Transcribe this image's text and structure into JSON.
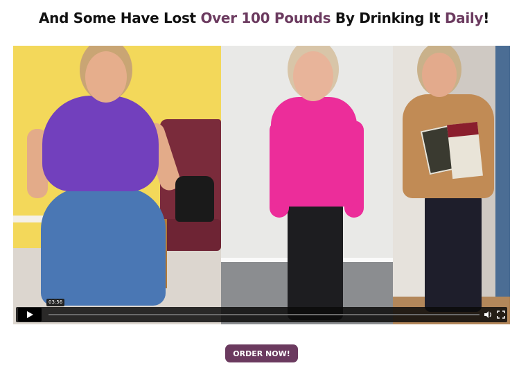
{
  "headline": {
    "part1": "And Some Have Lost ",
    "highlight1": "Over 100 Pounds",
    "part2": " By Drinking It ",
    "highlight2": "Daily",
    "part3": "!"
  },
  "colors": {
    "accent": "#6b3a5f",
    "text": "#111111",
    "button_text": "#ffffff"
  },
  "video": {
    "time_label": "03:56",
    "progress_fraction": 0,
    "controls_icons": [
      "play-icon",
      "volume-icon",
      "fullscreen-icon"
    ]
  },
  "cta": {
    "label": "ORDER NOW!"
  }
}
